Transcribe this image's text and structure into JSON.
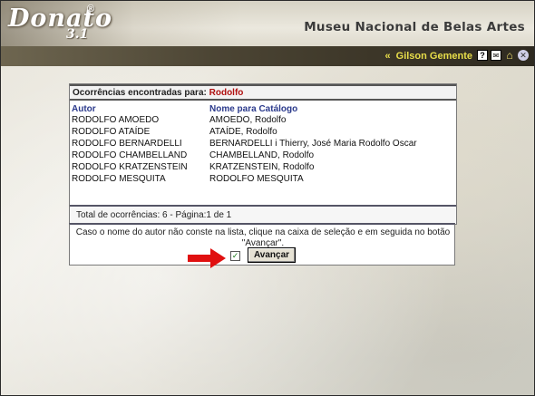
{
  "header": {
    "logo_text": "Donato",
    "logo_sub": "3.1",
    "logo_reg": "®",
    "museum_title": "Museu Nacional de Belas Artes"
  },
  "topbar": {
    "chevron": "«",
    "user_name": "Gilson Gemente",
    "icons": [
      "help-icon",
      "mail-icon",
      "home-icon",
      "close-icon"
    ]
  },
  "results": {
    "found_label": "Ocorrências encontradas para:",
    "search_term": "Rodolfo",
    "columns": [
      "Autor",
      "Nome para Catálogo"
    ],
    "rows": [
      [
        "RODOLFO AMOEDO",
        "AMOEDO, Rodolfo"
      ],
      [
        "RODOLFO ATAÍDE",
        "ATAÍDE, Rodolfo"
      ],
      [
        "RODOLFO BERNARDELLI",
        "BERNARDELLI i Thierry, José Maria Rodolfo Oscar"
      ],
      [
        "RODOLFO CHAMBELLAND",
        "CHAMBELLAND, Rodolfo"
      ],
      [
        "RODOLFO KRATZENSTEIN",
        "KRATZENSTEIN, Rodolfo"
      ],
      [
        "RODOLFO MESQUITA",
        "RODOLFO MESQUITA"
      ]
    ],
    "totals": "Total de ocorrências: 6 - Página:1 de 1"
  },
  "notice": {
    "text": "Caso o nome do autor não conste na lista, clique na caixa de seleção e em seguida no botão \"Avançar\".",
    "checkbox_checked": true,
    "advance_label": "Avançar"
  },
  "colors": {
    "search_term": "#b01010",
    "column_header": "#2b3a8c",
    "user_name": "#e8de4a",
    "arrow": "#e01010"
  }
}
